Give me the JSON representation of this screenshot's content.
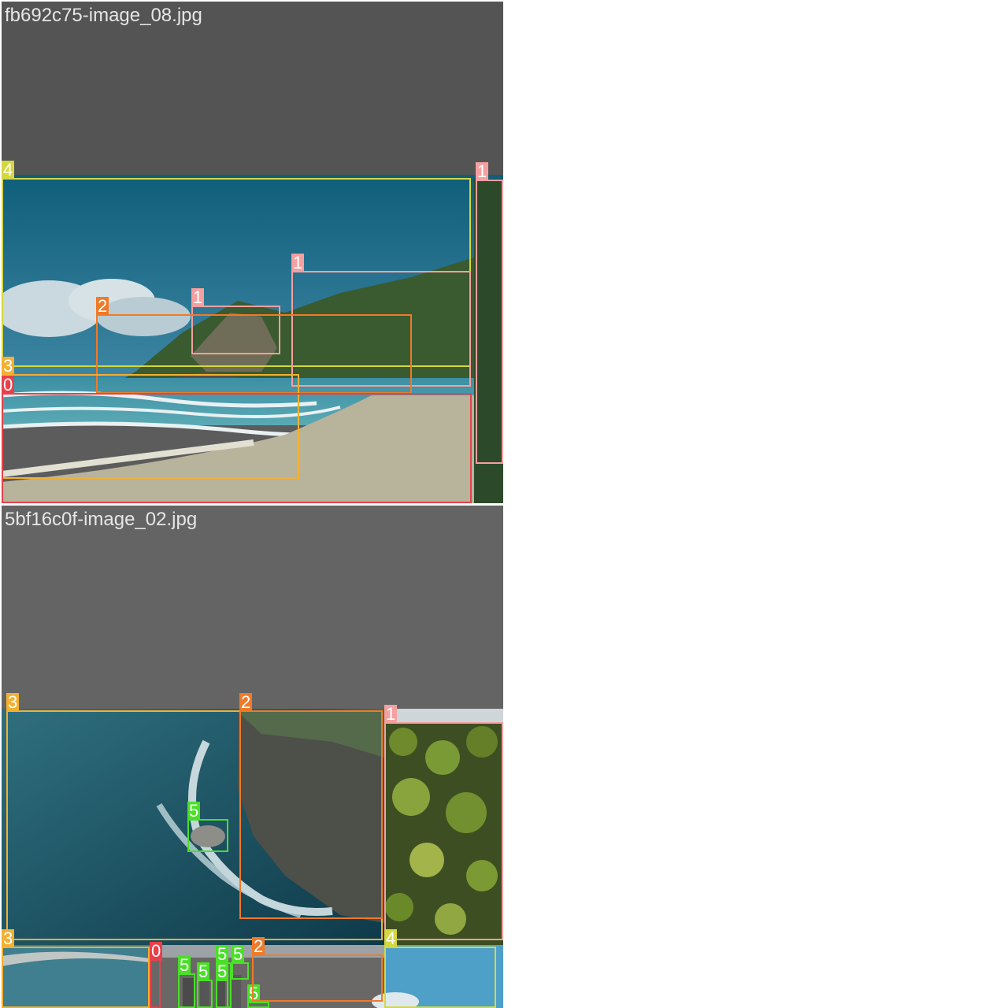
{
  "colors": {
    "class_0": "#e8404a",
    "class_1": "#f4a0a0",
    "class_2": "#f07a28",
    "class_3": "#f4b030",
    "class_4": "#d4d840",
    "class_5": "#4ae028",
    "panel_bg": "#5c5c5c",
    "page_bg": "#ffffff"
  },
  "tiles": [
    {
      "title": "fb692c75-image_08.jpg",
      "boxes": [
        {
          "label": "4",
          "class": "class_4"
        },
        {
          "label": "1",
          "class": "class_1"
        },
        {
          "label": "1",
          "class": "class_1"
        },
        {
          "label": "1",
          "class": "class_1"
        },
        {
          "label": "2",
          "class": "class_2"
        },
        {
          "label": "3",
          "class": "class_3"
        },
        {
          "label": "0",
          "class": "class_0"
        }
      ]
    },
    {
      "title": "5bf16c0f-image_02.jpg",
      "boxes": [
        {
          "label": "3",
          "class": "class_3"
        },
        {
          "label": "2",
          "class": "class_2"
        },
        {
          "label": "1",
          "class": "class_1"
        },
        {
          "label": "5",
          "class": "class_5"
        },
        {
          "label": "3",
          "class": "class_3"
        },
        {
          "label": "0",
          "class": "class_0"
        },
        {
          "label": "5",
          "class": "class_5"
        },
        {
          "label": "5",
          "class": "class_5"
        },
        {
          "label": "5",
          "class": "class_5"
        },
        {
          "label": "5",
          "class": "class_5"
        },
        {
          "label": "5",
          "class": "class_5"
        },
        {
          "label": "5",
          "class": "class_5"
        },
        {
          "label": "2",
          "class": "class_2"
        },
        {
          "label": "4",
          "class": "class_4"
        }
      ]
    }
  ]
}
